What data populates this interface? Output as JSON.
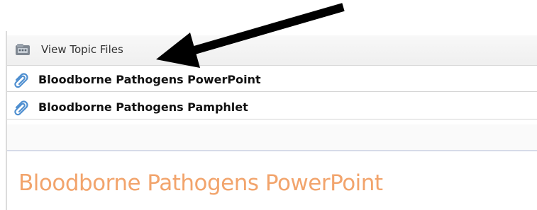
{
  "topic_bar": {
    "label": "View Topic Files",
    "icon": "folder-icon"
  },
  "files": [
    {
      "label": "Bloodborne Pathogens PowerPoint",
      "icon": "paperclip-icon"
    },
    {
      "label": "Bloodborne Pathogens Pamphlet",
      "icon": "paperclip-icon"
    }
  ],
  "section": {
    "heading": "Bloodborne Pathogens PowerPoint"
  },
  "colors": {
    "heading": "#f2a46c",
    "clip": "#4f8fd0",
    "arrow": "#000000"
  }
}
